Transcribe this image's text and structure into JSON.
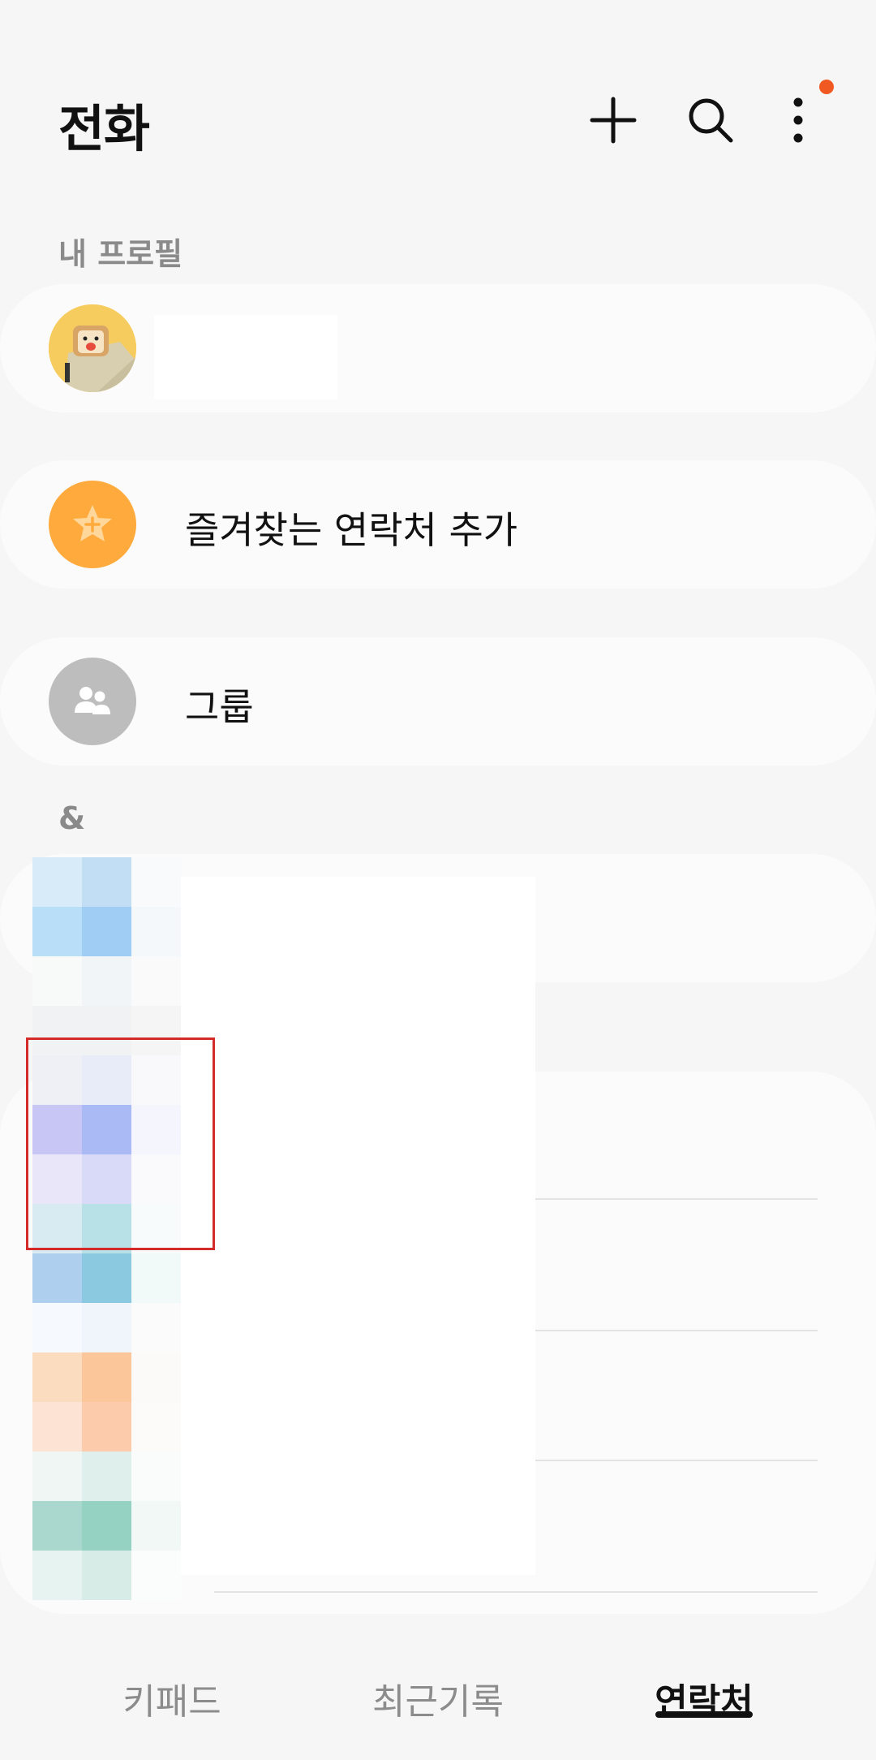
{
  "header": {
    "title": "전화",
    "add_icon": "plus-icon",
    "search_icon": "search-icon",
    "more_icon": "more-vertical-icon",
    "notification_color": "#f05a22"
  },
  "my_profile": {
    "section_label": "내 프로필",
    "avatar_icon": "toast-character-avatar"
  },
  "favorites": {
    "label": "즐겨찾는 연락처 추가",
    "icon": "star-add-icon",
    "icon_bg": "#ffaa3c"
  },
  "groups": {
    "label": "그룹",
    "icon": "people-icon",
    "icon_bg": "#bdbdbd"
  },
  "contacts": {
    "section_label": "&"
  },
  "bottom_nav": {
    "tabs": [
      {
        "label": "키패드"
      },
      {
        "label": "최근기록"
      },
      {
        "label": "연락처"
      }
    ],
    "active": "연락처"
  }
}
